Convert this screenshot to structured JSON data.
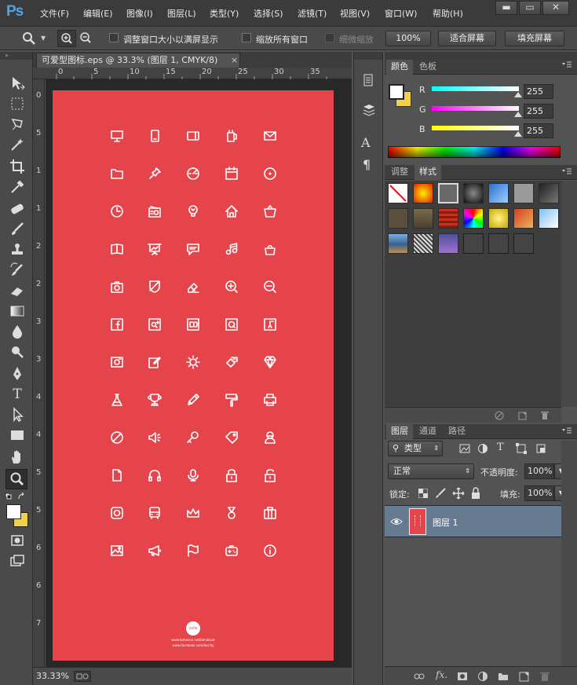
{
  "app": {
    "logo": "Ps"
  },
  "menu": [
    "文件(F)",
    "编辑(E)",
    "图像(I)",
    "图层(L)",
    "类型(Y)",
    "选择(S)",
    "滤镜(T)",
    "视图(V)",
    "窗口(W)",
    "帮助(H)"
  ],
  "window_controls": {
    "minimize": "▬",
    "maximize": "▭",
    "close": "✕"
  },
  "options_bar": {
    "resize_windows_label": "调整窗口大小以满屏显示",
    "zoom_all_label": "缩放所有窗口",
    "scrubby_zoom_label": "细微缩放",
    "zoom_100_button": "100%",
    "fit_screen_button": "适合屏幕",
    "fill_screen_button": "填充屏幕"
  },
  "document": {
    "tab_title": "可爱型图标.eps @ 33.3% (图层 1, CMYK/8)",
    "close_glyph": "×",
    "ruler_top": [
      "0",
      "5",
      "10",
      "15",
      "20",
      "25",
      "30",
      "35"
    ],
    "ruler_left": [
      "0",
      "5",
      "1",
      "1",
      "2",
      "2",
      "3",
      "3",
      "4",
      "4",
      "5",
      "5",
      "6",
      "6",
      "7"
    ],
    "artboard_color": "#e5444b",
    "icon_names": [
      [
        "monitor",
        "tablet",
        "phone-landscape",
        "cup",
        "mail"
      ],
      [
        "folder",
        "pin",
        "dashboard",
        "calendar",
        "location"
      ],
      [
        "clock",
        "radio",
        "bulb",
        "home",
        "basket"
      ],
      [
        "book",
        "presentation",
        "chat",
        "music",
        "bag"
      ],
      [
        "camera",
        "shield",
        "eraser",
        "zoom-in",
        "zoom-out"
      ],
      [
        "facebook",
        "qq",
        "douban",
        "weibo",
        "renren"
      ],
      [
        "photo",
        "edit",
        "settings",
        "paint",
        "diamond"
      ],
      [
        "flask",
        "trophy",
        "pencil",
        "roller",
        "printer"
      ],
      [
        "block",
        "speaker",
        "key",
        "tag",
        "user"
      ],
      [
        "document",
        "headphones",
        "microphone",
        "lock",
        "unlock"
      ],
      [
        "camera-app",
        "bus",
        "crown",
        "medal",
        "briefcase"
      ],
      [
        "image",
        "megaphone",
        "flag",
        "gamepad",
        "info"
      ]
    ],
    "footer_logo_text": "cute",
    "footer_line1": "www.behance.net/lamaksut",
    "footer_line2": "www.facebook.com/lucchy"
  },
  "status": {
    "zoom": "33.33%"
  },
  "color_panel": {
    "tabs": [
      "颜色",
      "色板"
    ],
    "channels": [
      {
        "label": "R",
        "value": "255"
      },
      {
        "label": "G",
        "value": "255"
      },
      {
        "label": "B",
        "value": "255"
      }
    ]
  },
  "styles_panel": {
    "tabs": [
      "调整",
      "样式"
    ]
  },
  "layers_panel": {
    "tabs": [
      "图层",
      "通道",
      "路径"
    ],
    "kind_filter": "类型",
    "blend_mode": "正常",
    "opacity_label": "不透明度:",
    "opacity_value": "100%",
    "lock_label": "锁定:",
    "fill_label": "填充:",
    "fill_value": "100%",
    "layers": [
      {
        "name": "图层 1",
        "visible": true
      }
    ]
  },
  "colors": {
    "accent_blue": "#4ea6ea",
    "artboard": "#e5444b",
    "selected_layer": "#667a91",
    "foreground_swatch": "#ffffff",
    "background_swatch": "#f1d04a"
  }
}
